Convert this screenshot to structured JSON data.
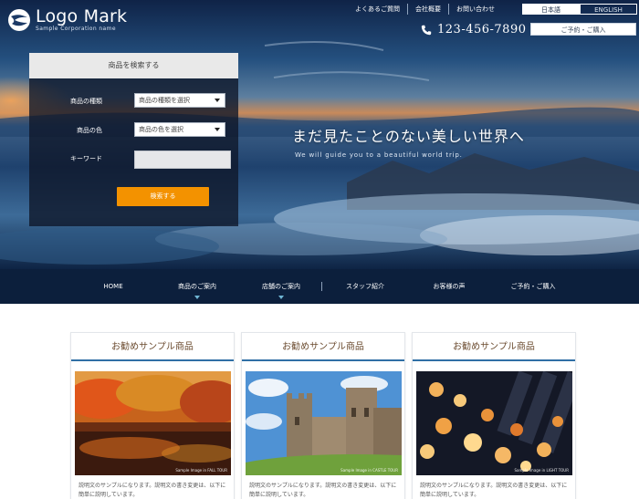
{
  "header": {
    "logo": {
      "name": "Logo Mark",
      "subtitle": "Sample Corporation name"
    },
    "top_links": [
      "よくあるご質問",
      "会社概要",
      "お問い合わせ"
    ],
    "languages": {
      "ja": "日本語",
      "en": "ENGLISH",
      "active": "ja"
    },
    "phone": "123-456-7890",
    "reserve_button": "ご予約・ご購入"
  },
  "search_panel": {
    "title": "商品を検索する",
    "fields": [
      {
        "label": "商品の種類",
        "value": "商品の種類を選択",
        "type": "select"
      },
      {
        "label": "商品の色",
        "value": "商品の色を選択",
        "type": "select"
      },
      {
        "label": "キーワード",
        "value": "",
        "type": "text"
      }
    ],
    "submit_label": "検索する"
  },
  "hero": {
    "title": "まだ見たことのない美しい世界へ",
    "subtitle": "We will guide you to a beautiful world trip."
  },
  "main_nav": [
    {
      "label": "HOME",
      "has_submenu": false
    },
    {
      "label": "商品のご案内",
      "has_submenu": true
    },
    {
      "label": "店舗のご案内",
      "has_submenu": true
    },
    {
      "label": "スタッフ紹介",
      "has_submenu": false
    },
    {
      "label": "お客様の声",
      "has_submenu": false
    },
    {
      "label": "ご予約・ご購入",
      "has_submenu": false
    }
  ],
  "products": [
    {
      "title": "お勧めサンプル商品",
      "image_caption": "Sample Image in FALL TOUR",
      "description": "説明文のサンプルになります。説明文の書き変更は、以下に簡単に説明しています。",
      "image": "autumn-lake"
    },
    {
      "title": "お勧めサンプル商品",
      "image_caption": "Sample Image in CASTLE TOUR",
      "description": "説明文のサンプルになります。説明文の書き変更は、以下に簡単に説明しています。",
      "image": "castle"
    },
    {
      "title": "お勧めサンプル商品",
      "image_caption": "Sample Image in LIGHT TOUR",
      "description": "説明文のサンプルになります。説明文の書き変更は、以下に簡単に説明しています。",
      "image": "lanterns"
    }
  ],
  "colors": {
    "accent": "#f39200",
    "nav_bg": "#0c1f3c",
    "card_rule": "#2f6fa5"
  }
}
